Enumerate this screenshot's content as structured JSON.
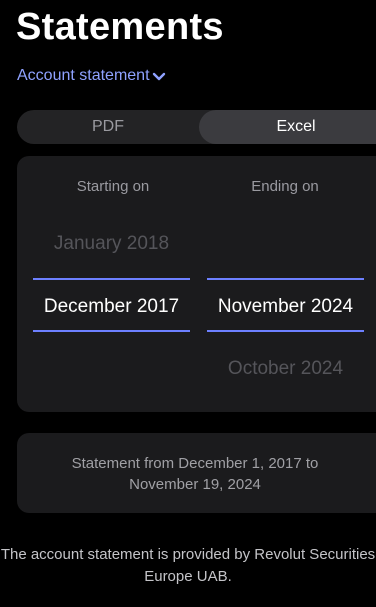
{
  "header": {
    "title": "Statements",
    "subnav_label": "Account statement"
  },
  "format_toggle": {
    "options": [
      "PDF",
      "Excel"
    ],
    "selected": "Excel"
  },
  "date_picker": {
    "start_header": "Starting on",
    "end_header": "Ending on",
    "start_column": {
      "above": "January 2018",
      "selected": "December 2017"
    },
    "end_column": {
      "selected": "November 2024",
      "below": "October 2024"
    }
  },
  "summary": {
    "text": "Statement from December 1, 2017 to November 19, 2024"
  },
  "footer": {
    "text": "The account statement is provided by Revolut Securities Europe UAB."
  },
  "colors": {
    "background": "#000000",
    "card": "#1b1b1d",
    "accent": "#6d80ff",
    "link": "#8fa2ff"
  }
}
